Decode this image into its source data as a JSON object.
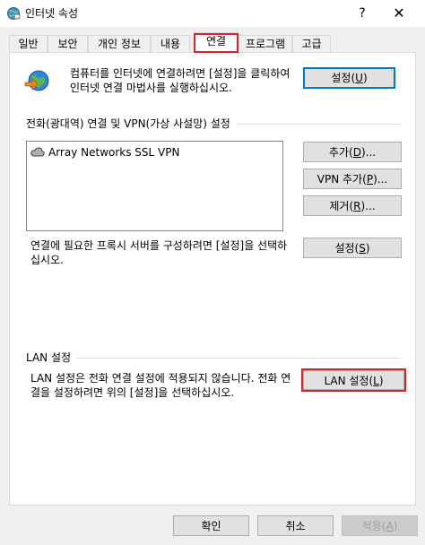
{
  "window": {
    "title": "인터넷 속성",
    "help_label": "?",
    "close_label": "✕"
  },
  "tabs": [
    {
      "label": "일반"
    },
    {
      "label": "보안"
    },
    {
      "label": "개인 정보"
    },
    {
      "label": "내용"
    },
    {
      "label": "연결",
      "active": true
    },
    {
      "label": "프로그램"
    },
    {
      "label": "고급"
    }
  ],
  "setup": {
    "description": "컴퓨터를 인터넷에 연결하려면 [설정]을 클릭하여 인터넷 연결 마법사를 실행하십시오.",
    "button_text": "설정",
    "button_mnemonic": "U"
  },
  "dialup": {
    "section_label": "전화(광대역) 연결 및 VPN(가상 사설망) 설정",
    "connections": [
      {
        "label": "Array Networks SSL VPN",
        "icon": "network-connection-icon"
      }
    ],
    "add_button": {
      "text": "추가",
      "mnemonic": "D",
      "suffix": "..."
    },
    "add_vpn_button": {
      "text": "VPN 추가",
      "mnemonic": "P",
      "suffix": "..."
    },
    "remove_button": {
      "text": "제거",
      "mnemonic": "R",
      "suffix": "..."
    },
    "proxy_description": "연결에 필요한 프록시 서버를 구성하려면 [설정]을 선택하십시오.",
    "settings_button": {
      "text": "설정",
      "mnemonic": "S"
    }
  },
  "lan": {
    "section_label": "LAN 설정",
    "description": "LAN 설정은 전화 연결 설정에 적용되지 않습니다. 전화 연결을 설정하려면 위의 [설정]을 선택하십시오.",
    "button": {
      "text": "LAN 설정",
      "mnemonic": "L"
    }
  },
  "footer": {
    "ok_label": "확인",
    "cancel_label": "취소",
    "apply_text": "적용",
    "apply_mnemonic": "A"
  },
  "colors": {
    "highlight": "#d9232b",
    "default_button_border": "#0078d7"
  }
}
